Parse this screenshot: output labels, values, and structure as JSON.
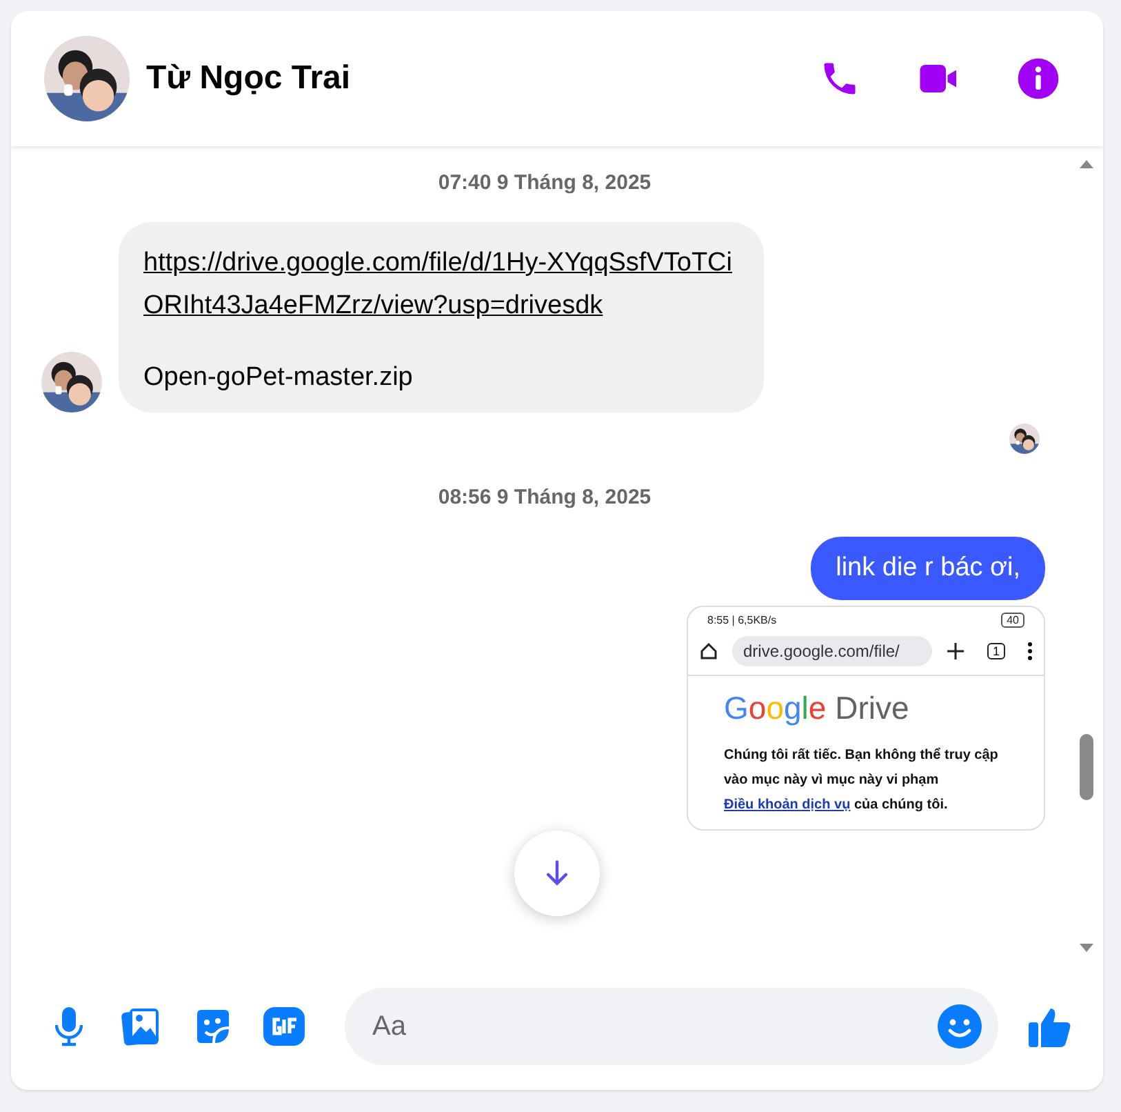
{
  "header": {
    "name": "Từ Ngọc Trai"
  },
  "messages": [
    {
      "kind": "timestamp",
      "text": "07:40 9 Tháng 8, 2025"
    },
    {
      "kind": "incoming",
      "link": "https://drive.google.com/file/d/1Hy-XYqqSsfVToTCiORIht43Ja4eFMZrz/view?usp=drivesdk",
      "text": "Open-goPet-master.zip"
    },
    {
      "kind": "seen"
    },
    {
      "kind": "timestamp",
      "text": "08:56 9 Tháng 8, 2025"
    },
    {
      "kind": "outgoing",
      "text": "link die r bác ơi,"
    },
    {
      "kind": "screenshot",
      "status": "8:55 | 6,5KB/s",
      "battery": "40",
      "url": "drive.google.com/file/",
      "tabs": "1",
      "logo_first": "Google",
      "logo_second": "Drive",
      "text_before": "Chúng tôi rất tiếc. Bạn không thể truy cập vào mục này vì mục này vi phạm",
      "link": "Điều khoản dịch vụ",
      "text_after": "của chúng tôi."
    }
  ],
  "composer": {
    "placeholder": "Aa"
  }
}
